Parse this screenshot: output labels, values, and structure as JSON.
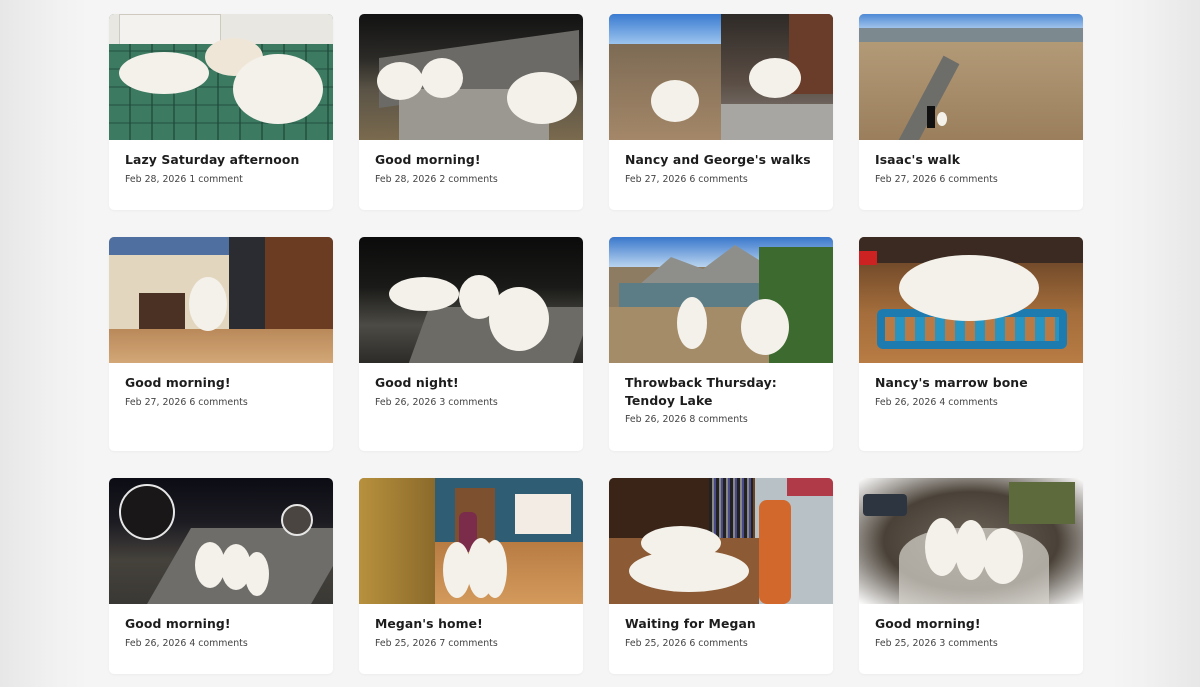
{
  "posts": [
    {
      "title": "Lazy Saturday afternoon",
      "date": "Feb 28, 2026",
      "comments": "1 comment"
    },
    {
      "title": "Good morning!",
      "date": "Feb 28, 2026",
      "comments": "2 comments"
    },
    {
      "title": "Nancy and George's walks",
      "date": "Feb 27, 2026",
      "comments": "6 comments"
    },
    {
      "title": "Isaac's walk",
      "date": "Feb 27, 2026",
      "comments": "6 comments"
    },
    {
      "title": "Good morning!",
      "date": "Feb 27, 2026",
      "comments": "6 comments"
    },
    {
      "title": "Good night!",
      "date": "Feb 26, 2026",
      "comments": "3 comments"
    },
    {
      "title": "Throwback Thursday: Tendoy Lake",
      "date": "Feb 26, 2026",
      "comments": "8 comments"
    },
    {
      "title": "Nancy's marrow bone",
      "date": "Feb 26, 2026",
      "comments": "4 comments"
    },
    {
      "title": "Good morning!",
      "date": "Feb 26, 2026",
      "comments": "4 comments"
    },
    {
      "title": "Megan's home!",
      "date": "Feb 25, 2026",
      "comments": "7 comments"
    },
    {
      "title": "Waiting for Megan",
      "date": "Feb 25, 2026",
      "comments": "6 comments"
    },
    {
      "title": "Good morning!",
      "date": "Feb 25, 2026",
      "comments": "3 comments"
    }
  ]
}
